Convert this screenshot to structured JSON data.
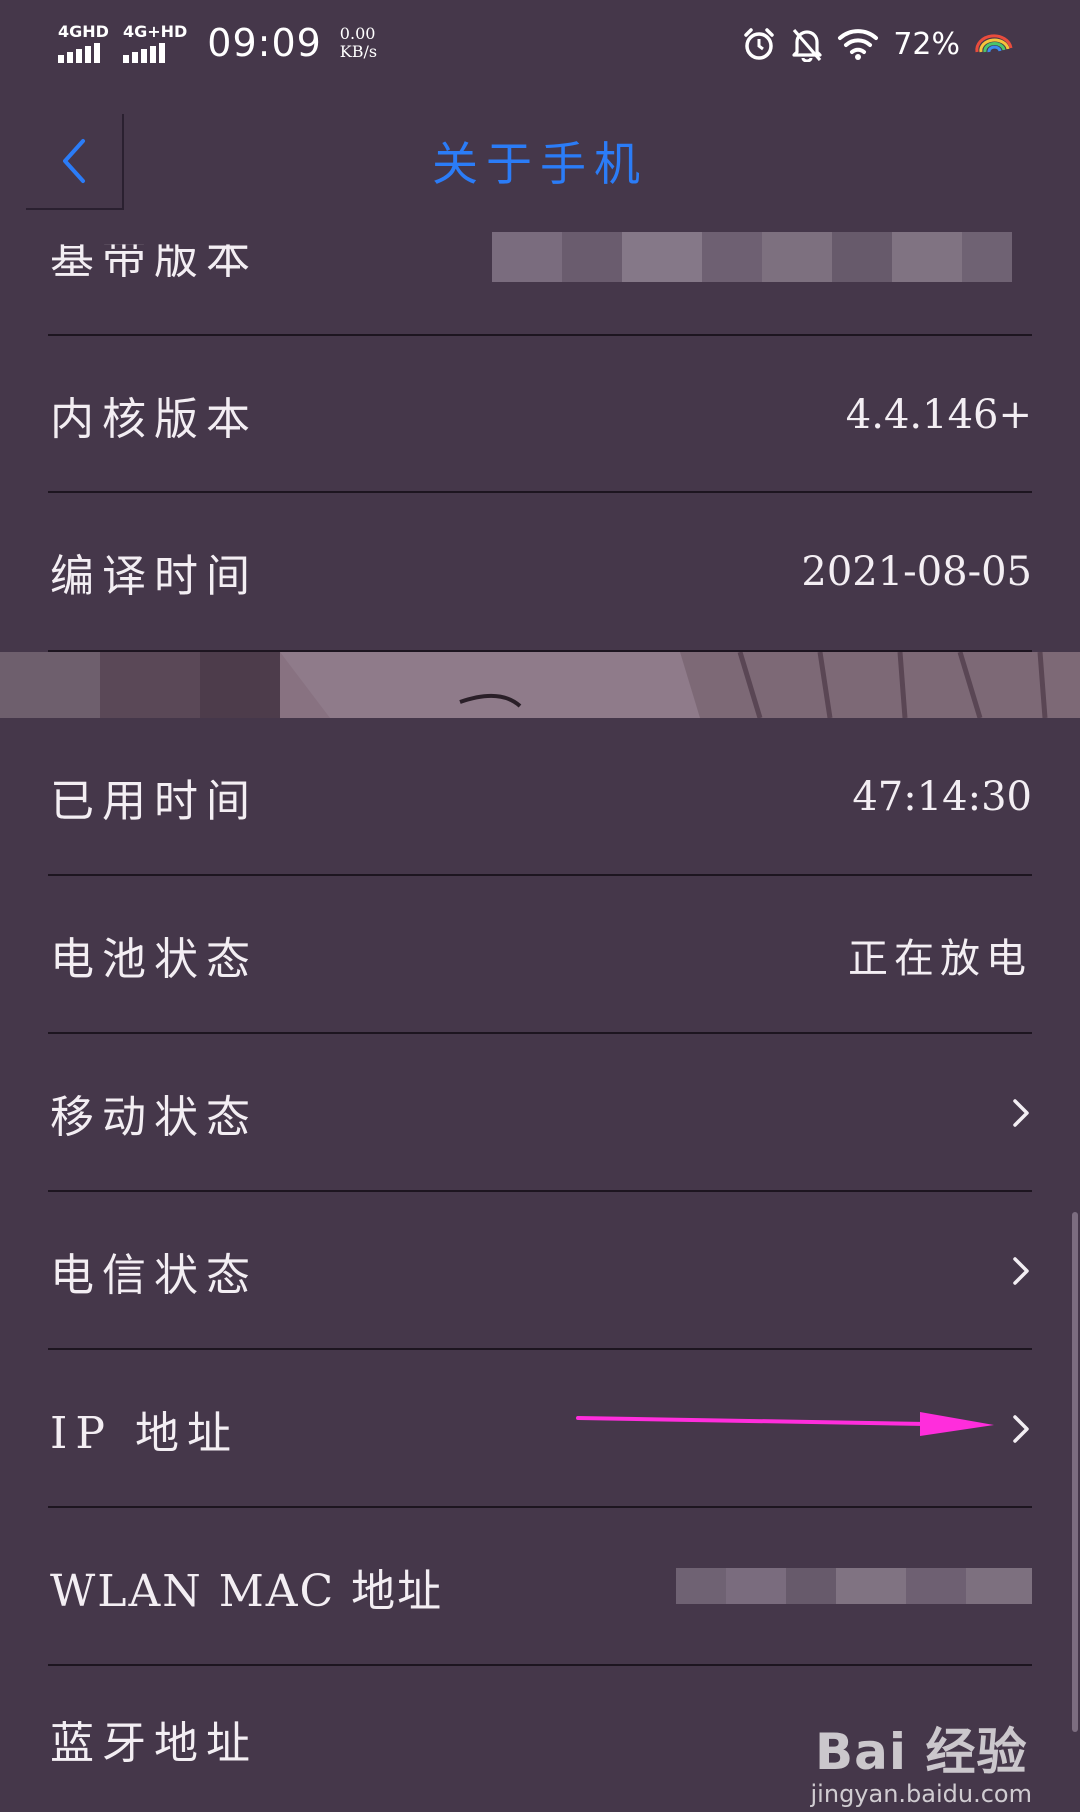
{
  "status_bar": {
    "network1": "4GHD",
    "network2": "4G+HD",
    "time": "09:09",
    "speed_value": "0.00",
    "speed_unit": "KB/s",
    "battery": "72%",
    "icons": [
      "alarm-icon",
      "bell-off-icon",
      "wifi-icon",
      "rainbow-icon"
    ]
  },
  "header": {
    "title": "关于手机",
    "back_icon": "back-chevron-icon"
  },
  "rows": [
    {
      "label": "基带版本",
      "value": ""
    },
    {
      "label": "内核版本",
      "value": "4.4.146+"
    },
    {
      "label": "编译时间",
      "value": "2021-08-05"
    },
    {
      "label": "已用时间",
      "value": "47:14:30"
    },
    {
      "label": "电池状态",
      "value": "正在放电"
    },
    {
      "label": "移动状态",
      "chevron": true
    },
    {
      "label": "电信状态",
      "chevron": true
    },
    {
      "label": "IP 地址",
      "chevron": true
    },
    {
      "label": "WLAN MAC 地址",
      "value": ""
    },
    {
      "label": "蓝牙地址",
      "value": ""
    }
  ],
  "watermark": {
    "logo": "Bai 经验",
    "url": "jingyan.baidu.com"
  },
  "colors": {
    "background": "#45374a",
    "title_blue": "#2b7cf7",
    "arrow_magenta": "#ff2ddc",
    "divider": "#1d1520"
  }
}
